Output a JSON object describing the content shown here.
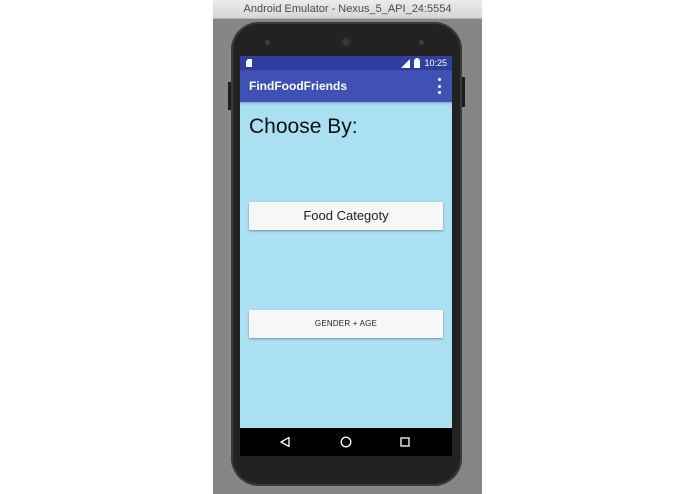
{
  "window": {
    "title": "Android Emulator - Nexus_5_API_24:5554"
  },
  "status_bar": {
    "time": "10:25",
    "icons": [
      "sd-card-icon",
      "signal-icon",
      "battery-icon"
    ]
  },
  "app_bar": {
    "title": "FindFoodFriends",
    "menu_icon": "overflow-menu-icon"
  },
  "main": {
    "heading": "Choose By:",
    "food_category_button": "Food Categoty",
    "gender_age_button": "GENDER + AGE"
  },
  "nav_bar": {
    "icons": [
      "back-icon",
      "home-icon",
      "recent-apps-icon"
    ]
  },
  "colors": {
    "status_bar": "#303f9f",
    "app_bar": "#3f51b5",
    "screen_background": "#abdff2",
    "button_background": "#f7f7f7"
  }
}
